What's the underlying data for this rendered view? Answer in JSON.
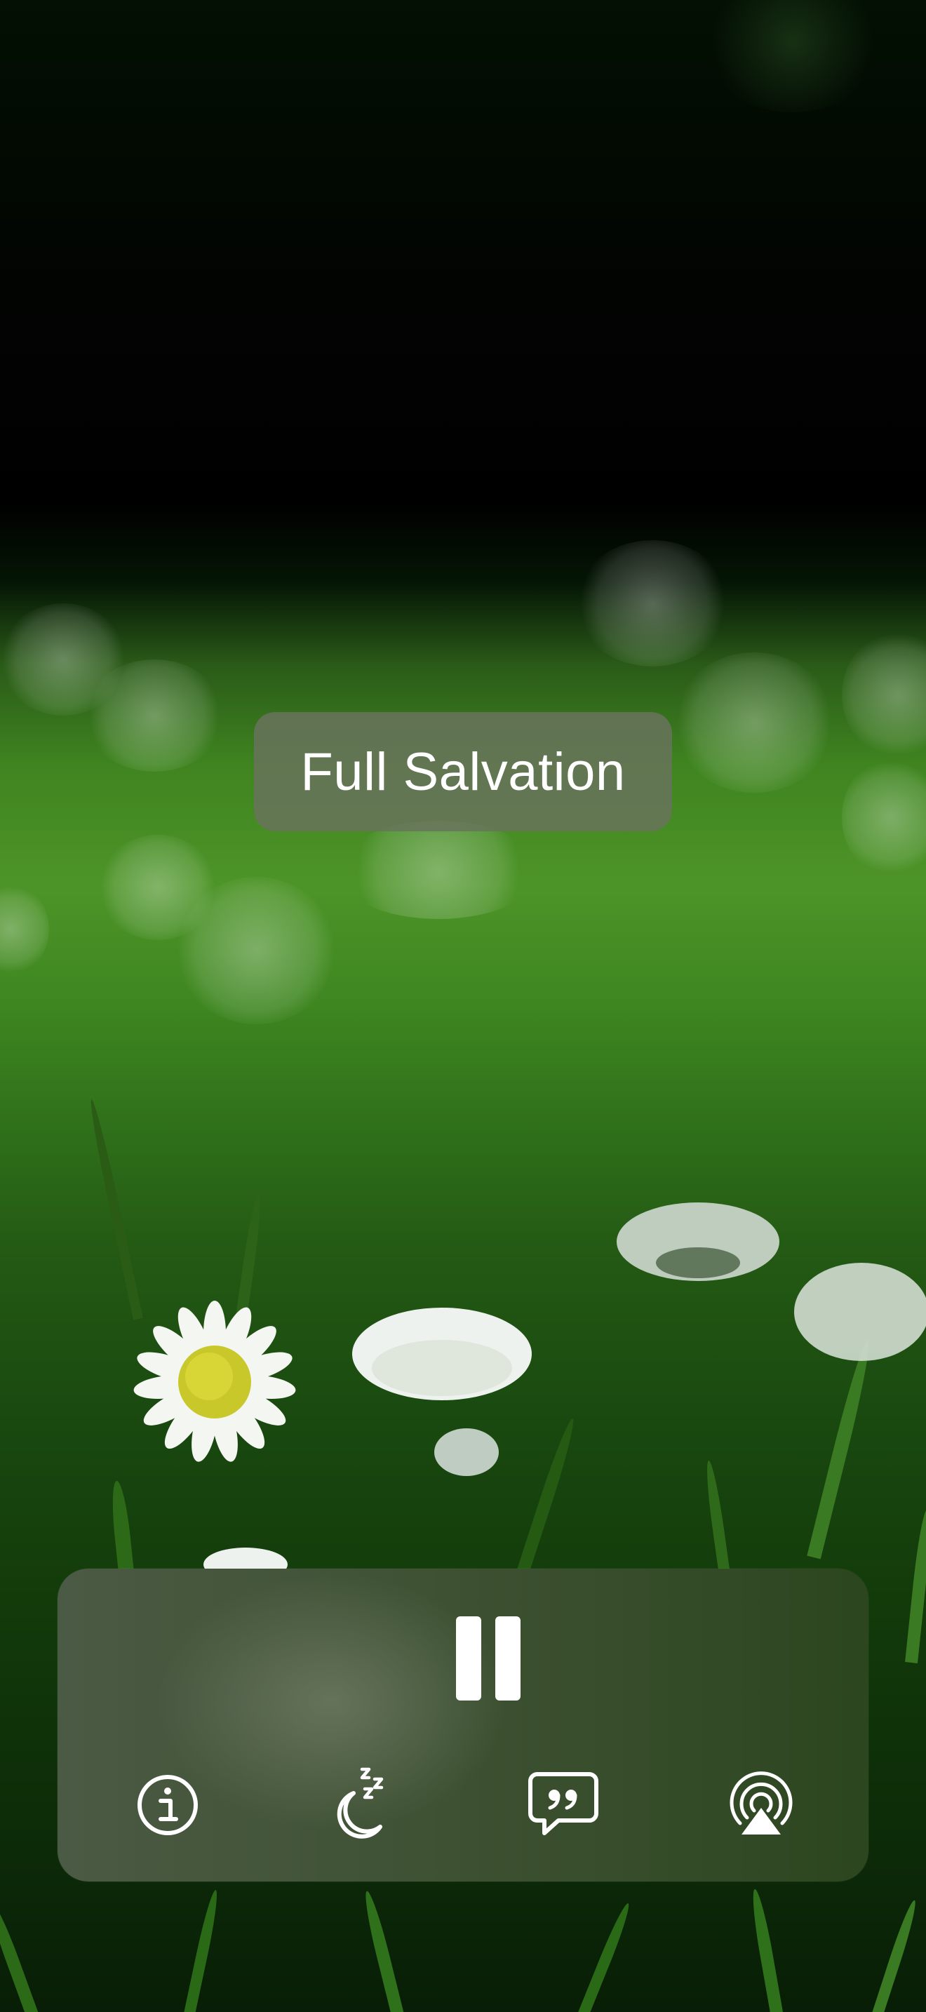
{
  "track": {
    "title": "Full Salvation"
  },
  "controls": {
    "pause_icon": "pause-icon",
    "info_icon": "info-circle-icon",
    "sleep_icon": "moon-zzz-icon",
    "quote_icon": "quote-bubble-icon",
    "airplay_icon": "airplay-icon"
  },
  "colors": {
    "panel": "#3f5234",
    "title_pill": "#69735c",
    "foreground": "#ffffff"
  }
}
